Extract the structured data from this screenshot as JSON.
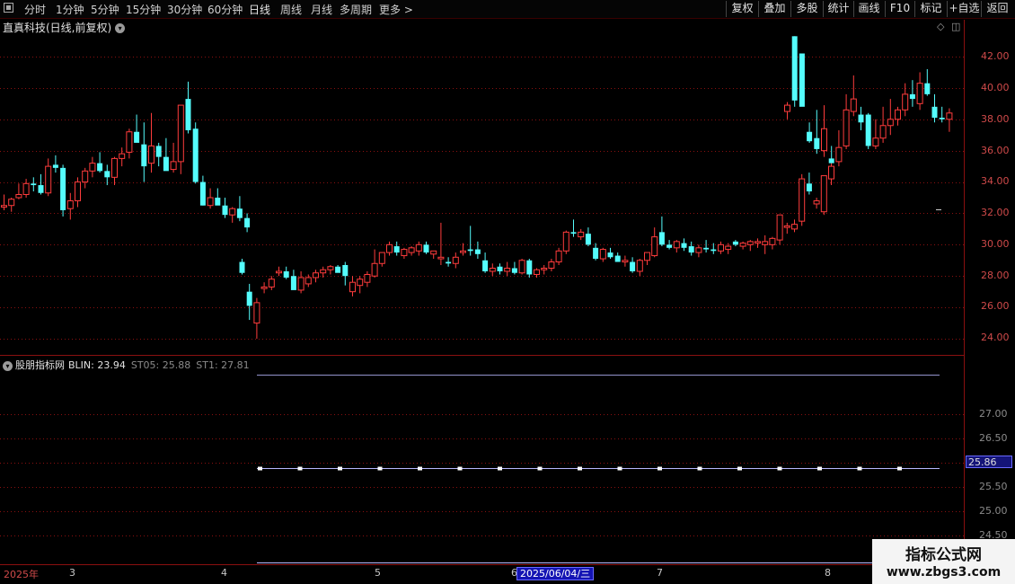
{
  "toolbar": {
    "periods": [
      "分时",
      "1分钟",
      "5分钟",
      "15分钟",
      "30分钟",
      "60分钟",
      "日线",
      "周线",
      "月线",
      "多周期",
      "更多 >"
    ],
    "active_period": "日线",
    "buttons": [
      "复权",
      "叠加",
      "多股",
      "统计",
      "画线",
      "F10",
      "标记",
      "+自选",
      "返回"
    ]
  },
  "stock": {
    "title": "直真科技(日线,前复权)"
  },
  "indicator": {
    "name": "股朋指标网",
    "blin": "BLIN: 23.94",
    "st05": "ST05: 25.88",
    "st1": "ST1: 27.81",
    "current_value": "25.86"
  },
  "xaxis": {
    "year_label": "2025年",
    "months": [
      "3",
      "4",
      "5",
      "6",
      "7",
      "8"
    ],
    "cursor_date": "2025/06/04/三"
  },
  "watermark": {
    "line1": "指标公式网",
    "line2": "www.zbgs3.com"
  },
  "colors": {
    "up": "#ff3c3c",
    "down": "#54fcfc",
    "grid": "#8a1010",
    "axis_text": "#d04a4a",
    "indicator_line": "#b8b8ff"
  },
  "chart_data": [
    {
      "type": "candlestick",
      "title": "直真科技(日线,前复权)",
      "ylim": [
        23.6,
        43.5
      ],
      "yticks": [
        "24.00",
        "26.00",
        "28.00",
        "30.00",
        "32.00",
        "34.00",
        "36.00",
        "38.00",
        "40.00",
        "42.00"
      ],
      "series": [
        {
          "values": [
            [
              32.4,
              33.2,
              32.2,
              32.5
            ],
            [
              32.5,
              33.0,
              32.1,
              32.9
            ],
            [
              33.0,
              33.9,
              32.9,
              33.2
            ],
            [
              33.2,
              34.2,
              33.0,
              33.9
            ],
            [
              33.9,
              34.3,
              33.4,
              33.8
            ],
            [
              33.8,
              34.5,
              33.2,
              33.3
            ],
            [
              33.3,
              35.5,
              33.1,
              35.0
            ],
            [
              35.1,
              35.7,
              34.6,
              34.9
            ],
            [
              34.9,
              35.1,
              31.8,
              32.2
            ],
            [
              32.3,
              33.3,
              31.6,
              32.8
            ],
            [
              32.8,
              34.3,
              32.4,
              34.0
            ],
            [
              34.0,
              34.9,
              33.6,
              34.7
            ],
            [
              34.7,
              35.6,
              34.3,
              35.2
            ],
            [
              35.2,
              35.9,
              34.6,
              34.7
            ],
            [
              34.7,
              35.1,
              33.8,
              34.3
            ],
            [
              34.3,
              35.6,
              33.8,
              35.5
            ],
            [
              35.5,
              36.2,
              35.0,
              35.8
            ],
            [
              35.9,
              37.4,
              35.5,
              37.2
            ],
            [
              37.2,
              38.3,
              36.9,
              36.5
            ],
            [
              36.4,
              37.8,
              34.0,
              35.0
            ],
            [
              35.2,
              38.4,
              34.6,
              36.3
            ],
            [
              36.3,
              36.5,
              35.0,
              35.6
            ],
            [
              35.6,
              36.8,
              35.2,
              34.7
            ],
            [
              34.8,
              36.5,
              34.6,
              35.3
            ],
            [
              35.3,
              38.9,
              34.5,
              38.9
            ],
            [
              39.3,
              40.4,
              37.1,
              37.3
            ],
            [
              37.4,
              37.8,
              33.9,
              34.0
            ],
            [
              34.0,
              34.4,
              32.5,
              32.5
            ],
            [
              32.5,
              33.6,
              32.3,
              33.0
            ],
            [
              33.0,
              33.6,
              32.7,
              32.5
            ],
            [
              32.5,
              33.0,
              31.7,
              31.9
            ],
            [
              31.9,
              32.4,
              31.4,
              32.3
            ],
            [
              32.3,
              33.1,
              31.5,
              31.7
            ],
            [
              31.7,
              32.0,
              30.8,
              31.1
            ]
          ]
        },
        {
          "values": [
            [
              28.9,
              29.1,
              28.1,
              28.2
            ],
            [
              27.0,
              27.5,
              25.2,
              26.1
            ],
            [
              25.0,
              26.6,
              24.0,
              26.3
            ],
            [
              27.2,
              27.6,
              26.9,
              27.3
            ],
            [
              27.3,
              28.0,
              27.1,
              27.8
            ],
            [
              28.2,
              28.6,
              28.0,
              28.3
            ],
            [
              28.3,
              28.6,
              27.8,
              27.9
            ],
            [
              28.0,
              28.4,
              27.6,
              27.1
            ],
            [
              27.1,
              28.3,
              26.9,
              27.9
            ],
            [
              27.5,
              28.1,
              27.3,
              27.9
            ],
            [
              27.9,
              28.4,
              27.6,
              28.2
            ],
            [
              28.2,
              28.6,
              27.9,
              28.4
            ],
            [
              28.4,
              28.7,
              28.1,
              28.6
            ],
            [
              28.6,
              28.7,
              28.3,
              28.2
            ],
            [
              28.7,
              28.9,
              27.4,
              28.0
            ],
            [
              27.0,
              28.0,
              26.7,
              27.6
            ],
            [
              27.4,
              28.0,
              26.9,
              27.8
            ],
            [
              27.6,
              28.3,
              27.3,
              28.1
            ],
            [
              28.0,
              29.7,
              27.9,
              28.8
            ],
            [
              28.8,
              29.5,
              28.6,
              29.5
            ],
            [
              29.5,
              30.2,
              29.3,
              30.0
            ],
            [
              29.9,
              30.2,
              29.3,
              29.5
            ],
            [
              29.3,
              29.8,
              29.1,
              29.7
            ],
            [
              29.5,
              29.9,
              29.3,
              29.8
            ],
            [
              29.6,
              30.2,
              29.3,
              30.0
            ],
            [
              30.0,
              30.2,
              29.4,
              29.5
            ],
            [
              29.4,
              29.5,
              29.1,
              29.6
            ],
            [
              29.1,
              31.4,
              28.7,
              29.2
            ],
            [
              28.9,
              29.2,
              28.6,
              28.8
            ],
            [
              28.8,
              29.5,
              28.5,
              29.2
            ],
            [
              29.5,
              30.1,
              29.3,
              29.6
            ],
            [
              29.7,
              31.2,
              29.3,
              29.6
            ],
            [
              29.7,
              30.2,
              29.1,
              29.4
            ],
            [
              29.0,
              29.5,
              28.2,
              28.3
            ],
            [
              28.3,
              28.8,
              28.0,
              28.5
            ],
            [
              28.6,
              28.8,
              28.1,
              28.3
            ],
            [
              28.3,
              28.9,
              28.0,
              28.5
            ],
            [
              28.5,
              28.9,
              28.1,
              28.2
            ],
            [
              28.2,
              29.1,
              28.1,
              29.0
            ],
            [
              29.0,
              29.1,
              27.9,
              28.1
            ],
            [
              28.1,
              28.5,
              27.9,
              28.4
            ],
            [
              28.4,
              28.7,
              28.1,
              28.5
            ],
            [
              28.5,
              29.1,
              28.3,
              28.9
            ],
            [
              28.9,
              29.8,
              28.7,
              29.6
            ],
            [
              29.6,
              30.9,
              29.4,
              30.8
            ],
            [
              30.8,
              31.6,
              30.5,
              30.7
            ],
            [
              30.5,
              31.0,
              30.3,
              30.8
            ],
            [
              30.7,
              31.1,
              29.9,
              30.0
            ],
            [
              29.8,
              30.1,
              29.0,
              29.1
            ],
            [
              29.1,
              29.8,
              28.9,
              29.7
            ],
            [
              29.5,
              29.8,
              29.1,
              29.2
            ],
            [
              29.3,
              29.5,
              28.9,
              28.9
            ],
            [
              28.9,
              29.3,
              28.6,
              29.0
            ],
            [
              28.9,
              29.2,
              28.2,
              28.3
            ],
            [
              28.3,
              29.1,
              28.0,
              29.0
            ],
            [
              29.0,
              29.5,
              28.7,
              29.5
            ],
            [
              29.3,
              31.1,
              29.2,
              30.5
            ],
            [
              30.8,
              31.8,
              29.9,
              30.0
            ],
            [
              30.0,
              30.3,
              29.7,
              29.8
            ],
            [
              29.8,
              30.3,
              29.5,
              30.2
            ],
            [
              30.1,
              30.4,
              29.6,
              29.8
            ],
            [
              29.9,
              30.2,
              29.3,
              29.5
            ],
            [
              29.5,
              30.0,
              29.2,
              29.8
            ],
            [
              29.8,
              30.3,
              29.5,
              29.7
            ],
            [
              29.7,
              30.1,
              29.4,
              29.6
            ],
            [
              29.6,
              30.2,
              29.4,
              30.0
            ],
            [
              29.7,
              30.1,
              29.4,
              29.9
            ],
            [
              30.2,
              30.3,
              29.9,
              30.0
            ],
            [
              29.9,
              30.2,
              29.7,
              30.1
            ],
            [
              30.0,
              30.3,
              29.6,
              30.2
            ],
            [
              30.1,
              30.4,
              29.8,
              30.2
            ],
            [
              30.0,
              30.6,
              29.4,
              30.2
            ],
            [
              30.0,
              30.5,
              29.7,
              30.4
            ],
            [
              30.3,
              31.6,
              30.0,
              31.9
            ],
            [
              31.1,
              31.4,
              30.7,
              31.2
            ],
            [
              31.0,
              31.6,
              30.8,
              31.3
            ],
            [
              31.5,
              34.5,
              31.2,
              34.2
            ],
            [
              33.9,
              34.6,
              33.2,
              33.4
            ],
            [
              32.6,
              33.0,
              32.3,
              32.8
            ],
            [
              32.1,
              34.0,
              31.9,
              34.4
            ],
            [
              34.2,
              35.2,
              33.8,
              35.0
            ]
          ]
        },
        {
          "values": [
            [
              38.5,
              39.1,
              38.0,
              38.9
            ],
            [
              43.3,
              43.3,
              38.8,
              39.2
            ],
            [
              42.2,
              42.2,
              38.9,
              38.8
            ],
            [
              37.2,
              37.8,
              36.5,
              36.6
            ],
            [
              36.8,
              38.6,
              35.8,
              36.1
            ],
            [
              36.0,
              38.9,
              35.6,
              37.4
            ],
            [
              35.5,
              36.3,
              35.2,
              35.2
            ],
            [
              35.3,
              37.3,
              35.0,
              36.2
            ],
            [
              36.3,
              39.6,
              36.1,
              38.6
            ],
            [
              38.5,
              40.8,
              38.2,
              39.3
            ],
            [
              38.3,
              38.8,
              37.3,
              37.8
            ],
            [
              38.3,
              38.4,
              36.1,
              36.3
            ],
            [
              36.3,
              38.0,
              36.1,
              36.8
            ],
            [
              36.8,
              38.8,
              36.5,
              37.6
            ],
            [
              37.6,
              39.3,
              37.0,
              38.0
            ],
            [
              38.0,
              38.8,
              37.6,
              38.6
            ],
            [
              38.6,
              40.3,
              38.2,
              39.6
            ],
            [
              39.6,
              40.5,
              38.8,
              39.3
            ],
            [
              39.0,
              41.0,
              38.6,
              40.3
            ],
            [
              40.3,
              41.2,
              39.5,
              39.6
            ],
            [
              38.8,
              39.6,
              37.8,
              38.1
            ],
            [
              38.1,
              38.8,
              37.8,
              38.0
            ],
            [
              38.0,
              38.7,
              37.2,
              38.4
            ]
          ]
        }
      ]
    },
    {
      "type": "line",
      "title": "股朋指标网",
      "ylim": [
        24.35,
        28.3
      ],
      "yticks": [
        "24.50",
        "25.00",
        "25.50",
        "26.00",
        "26.50",
        "27.00"
      ],
      "series": [
        {
          "name": "BLIN",
          "values": [
            23.94
          ]
        },
        {
          "name": "ST05",
          "values": [
            25.88
          ]
        },
        {
          "name": "ST1",
          "values": [
            27.81
          ]
        }
      ]
    }
  ]
}
